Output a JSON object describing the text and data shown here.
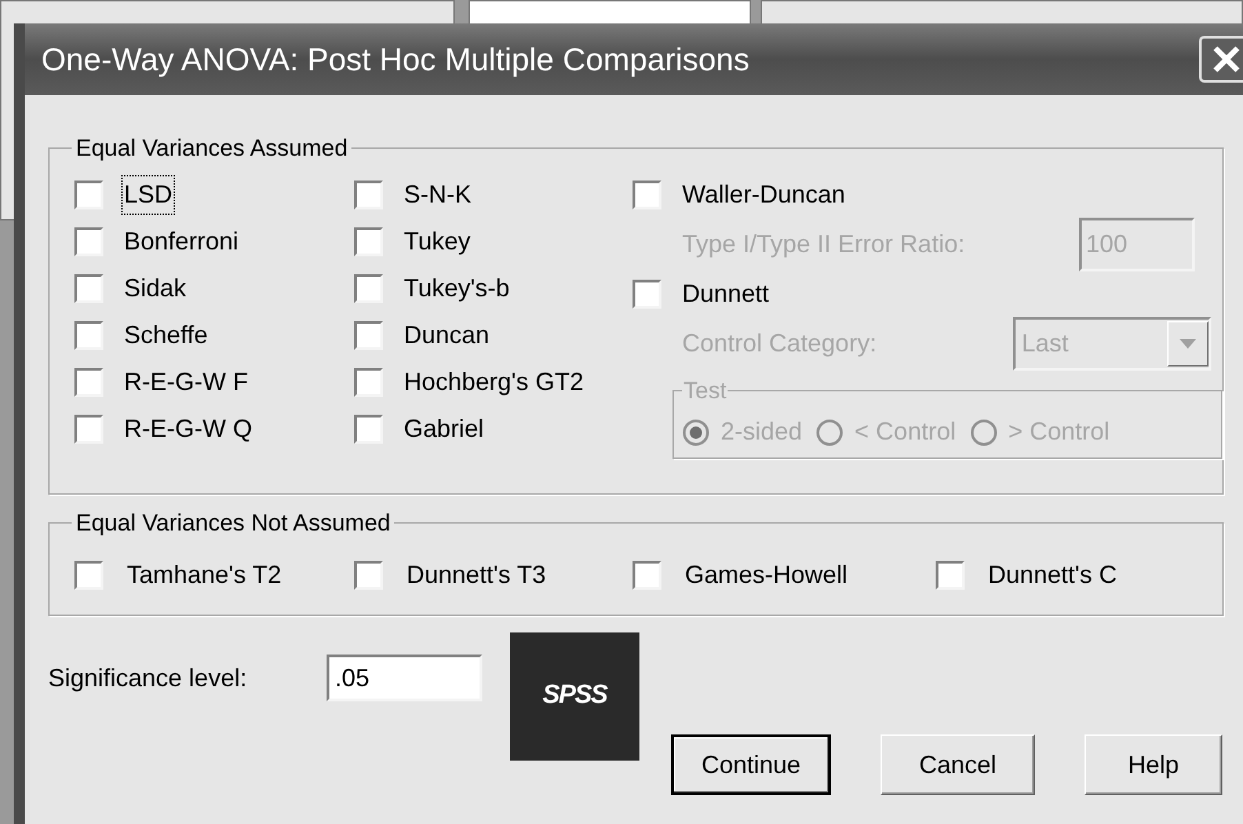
{
  "dialog": {
    "title": "One-Way ANOVA: Post Hoc Multiple Comparisons",
    "assumed": {
      "label": "Equal Variances Assumed",
      "column_1": [
        {
          "label": "LSD",
          "checked": false,
          "focused": true
        },
        {
          "label": "Bonferroni",
          "checked": false,
          "focused": false
        },
        {
          "label": "Sidak",
          "checked": false,
          "focused": false
        },
        {
          "label": "Scheffe",
          "checked": false,
          "focused": false
        },
        {
          "label": "R-E-G-W F",
          "checked": false,
          "focused": false
        },
        {
          "label": "R-E-G-W Q",
          "checked": false,
          "focused": false
        }
      ],
      "column_2": [
        {
          "label": "S-N-K",
          "checked": false,
          "focused": false
        },
        {
          "label": "Tukey",
          "checked": false,
          "focused": false
        },
        {
          "label": "Tukey's-b",
          "checked": false,
          "focused": false
        },
        {
          "label": "Duncan",
          "checked": false,
          "focused": false
        },
        {
          "label": "Hochberg's GT2",
          "checked": false,
          "focused": false
        },
        {
          "label": "Gabriel",
          "checked": false,
          "focused": false
        }
      ],
      "waller_duncan": {
        "label": "Waller-Duncan",
        "checked": false
      },
      "error_ratio": {
        "label": "Type I/Type II Error Ratio:",
        "value": "100",
        "disabled": true
      },
      "dunnett": {
        "label": "Dunnett",
        "checked": false
      },
      "control_category": {
        "label": "Control Category:",
        "value": "Last",
        "disabled": true
      },
      "test": {
        "label": "Test",
        "disabled": true,
        "options": [
          {
            "label": "2-sided",
            "selected": true
          },
          {
            "label": "< Control",
            "selected": false
          },
          {
            "label": "> Control",
            "selected": false
          }
        ]
      }
    },
    "not_assumed": {
      "label": "Equal Variances Not Assumed",
      "options": [
        {
          "label": "Tamhane's T2",
          "checked": false
        },
        {
          "label": "Dunnett's T3",
          "checked": false
        },
        {
          "label": "Games-Howell",
          "checked": false
        },
        {
          "label": "Dunnett's C",
          "checked": false
        }
      ]
    },
    "significance": {
      "label": "Significance level:",
      "value": ".05"
    },
    "logo": "SPSS",
    "buttons": [
      {
        "label": "Continue",
        "default": true
      },
      {
        "label": "Cancel",
        "default": false
      },
      {
        "label": "Help",
        "default": false
      }
    ]
  }
}
